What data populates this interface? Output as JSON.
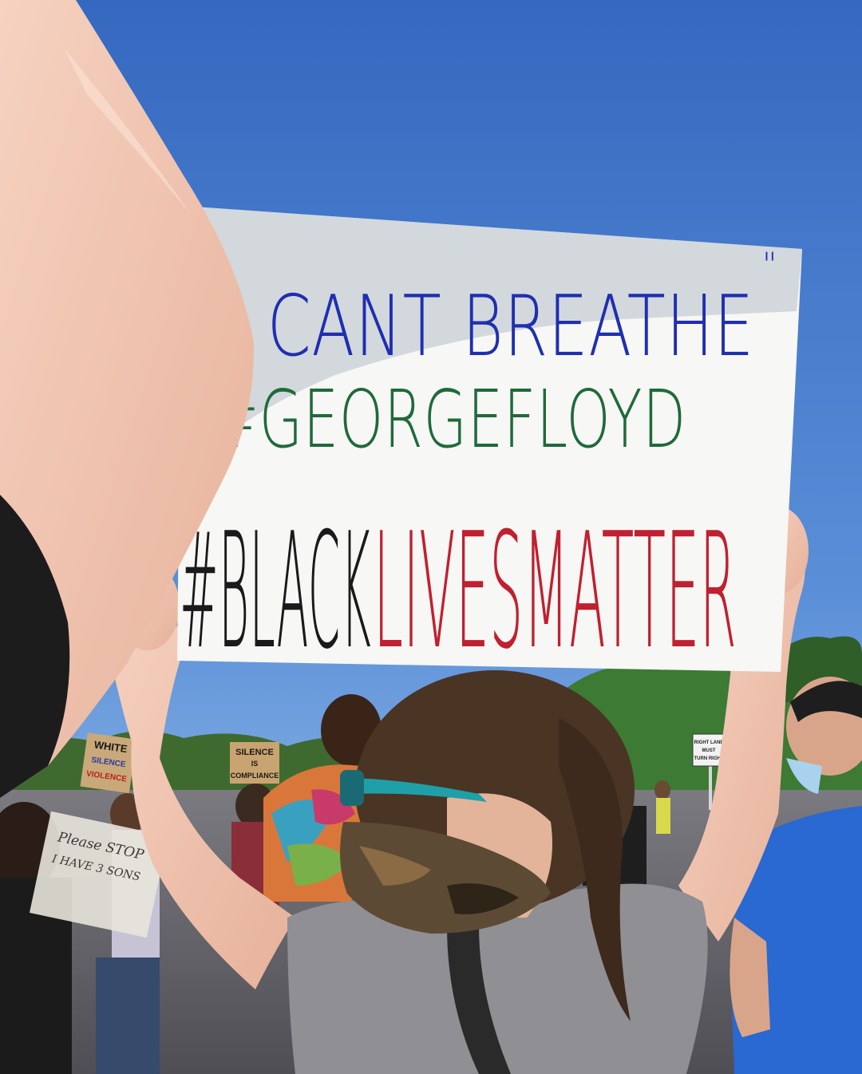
{
  "main_sign": {
    "line1": "I CANT BREATHE",
    "line1_quote": "\"",
    "line2": "#GEORGEFLOYD",
    "line3_black": "#BLACK",
    "line3_red": "LIVESMATTER"
  },
  "background_signs": {
    "silence_sign_line1": "SILENCE",
    "silence_sign_line2": "IS",
    "silence_sign_line3": "COMPLIANCE",
    "white_silence_line1": "WHITE",
    "white_silence_line2": "SILENCE",
    "white_silence_line3": "VIOLENCE",
    "handwritten_line1": "Please STOP",
    "handwritten_line2": "I HAVE 3 SONS",
    "road_sign_line1": "RIGHT LANE",
    "road_sign_line2": "MUST",
    "road_sign_line3": "TURN RIGHT"
  },
  "colors": {
    "sky_top": "#3568bf",
    "sky_bottom": "#8fb8e6",
    "blue_marker": "#1f2fb0",
    "green_marker": "#1f6a3a",
    "red_marker": "#c0202f",
    "black_marker": "#1a1a1a"
  }
}
